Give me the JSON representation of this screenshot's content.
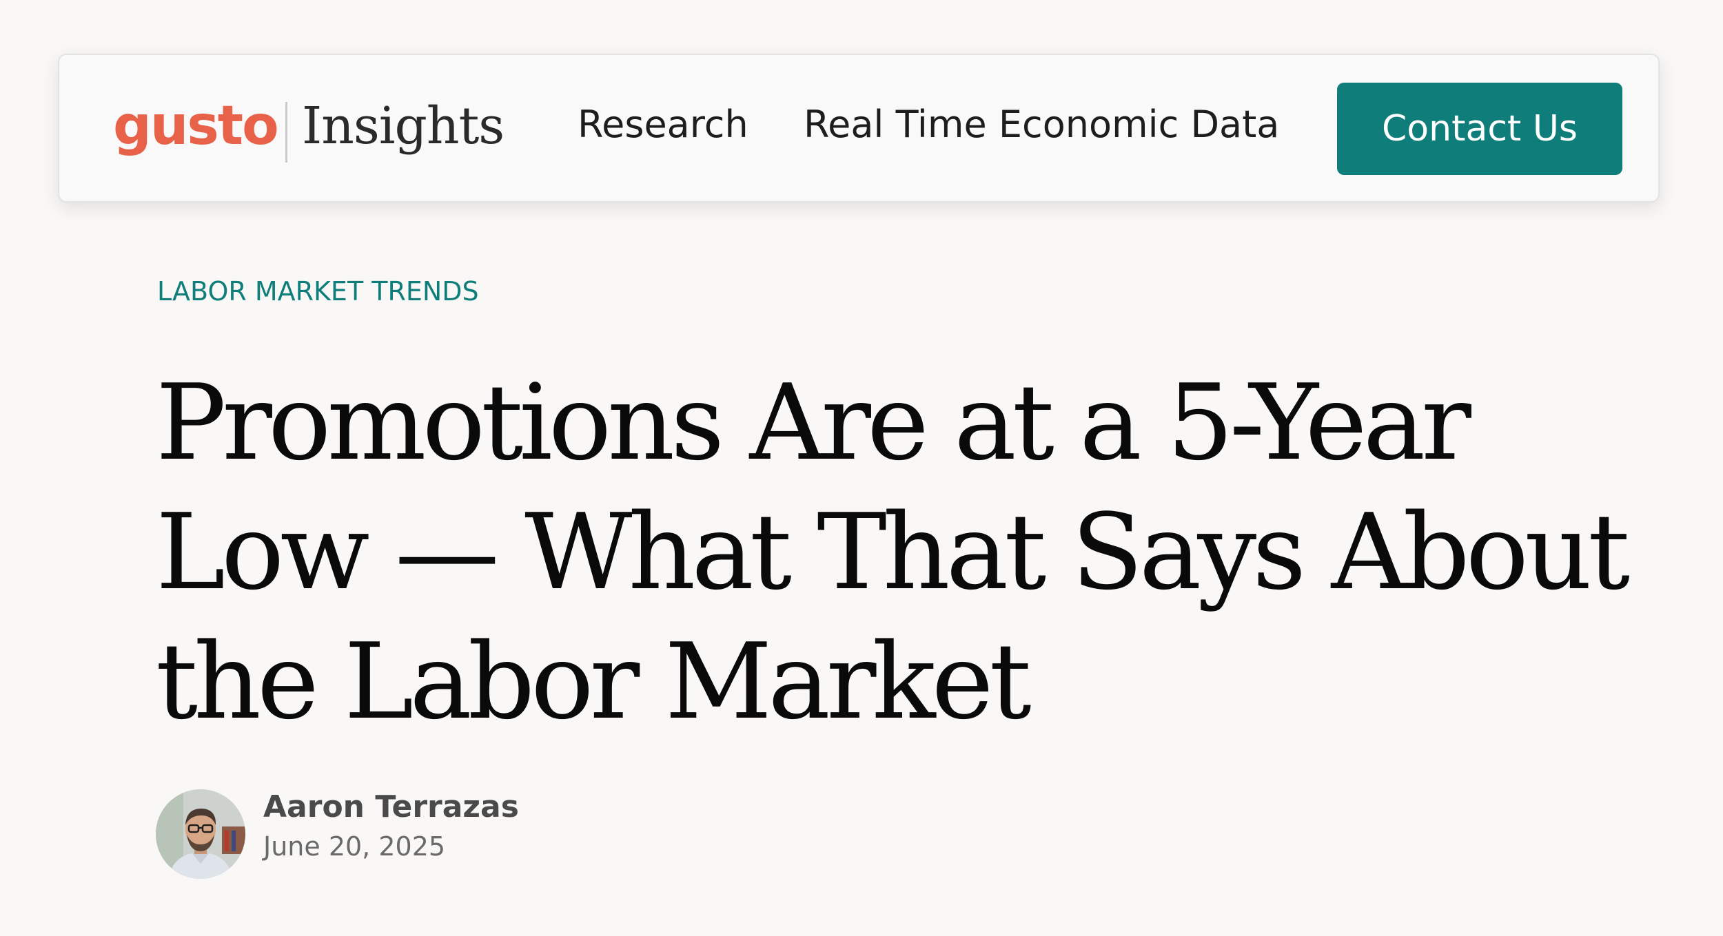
{
  "header": {
    "logo": {
      "brand": "gusto",
      "product": "Insights"
    },
    "nav": [
      {
        "label": "Research"
      },
      {
        "label": "Real Time Economic Data"
      }
    ],
    "cta_label": "Contact Us"
  },
  "article": {
    "category": "LABOR MARKET TRENDS",
    "title": "Promotions Are at a 5-Year Low — What That Says About the Labor Market",
    "author": {
      "name": "Aaron Terrazas",
      "avatar_icon": "author-photo"
    },
    "date": "June 20, 2025"
  },
  "colors": {
    "page_background": "#f9f8f6",
    "brand_logo": "#e8624a",
    "accent_teal": "#0f7e7b",
    "headline": "#0a0a0a"
  }
}
